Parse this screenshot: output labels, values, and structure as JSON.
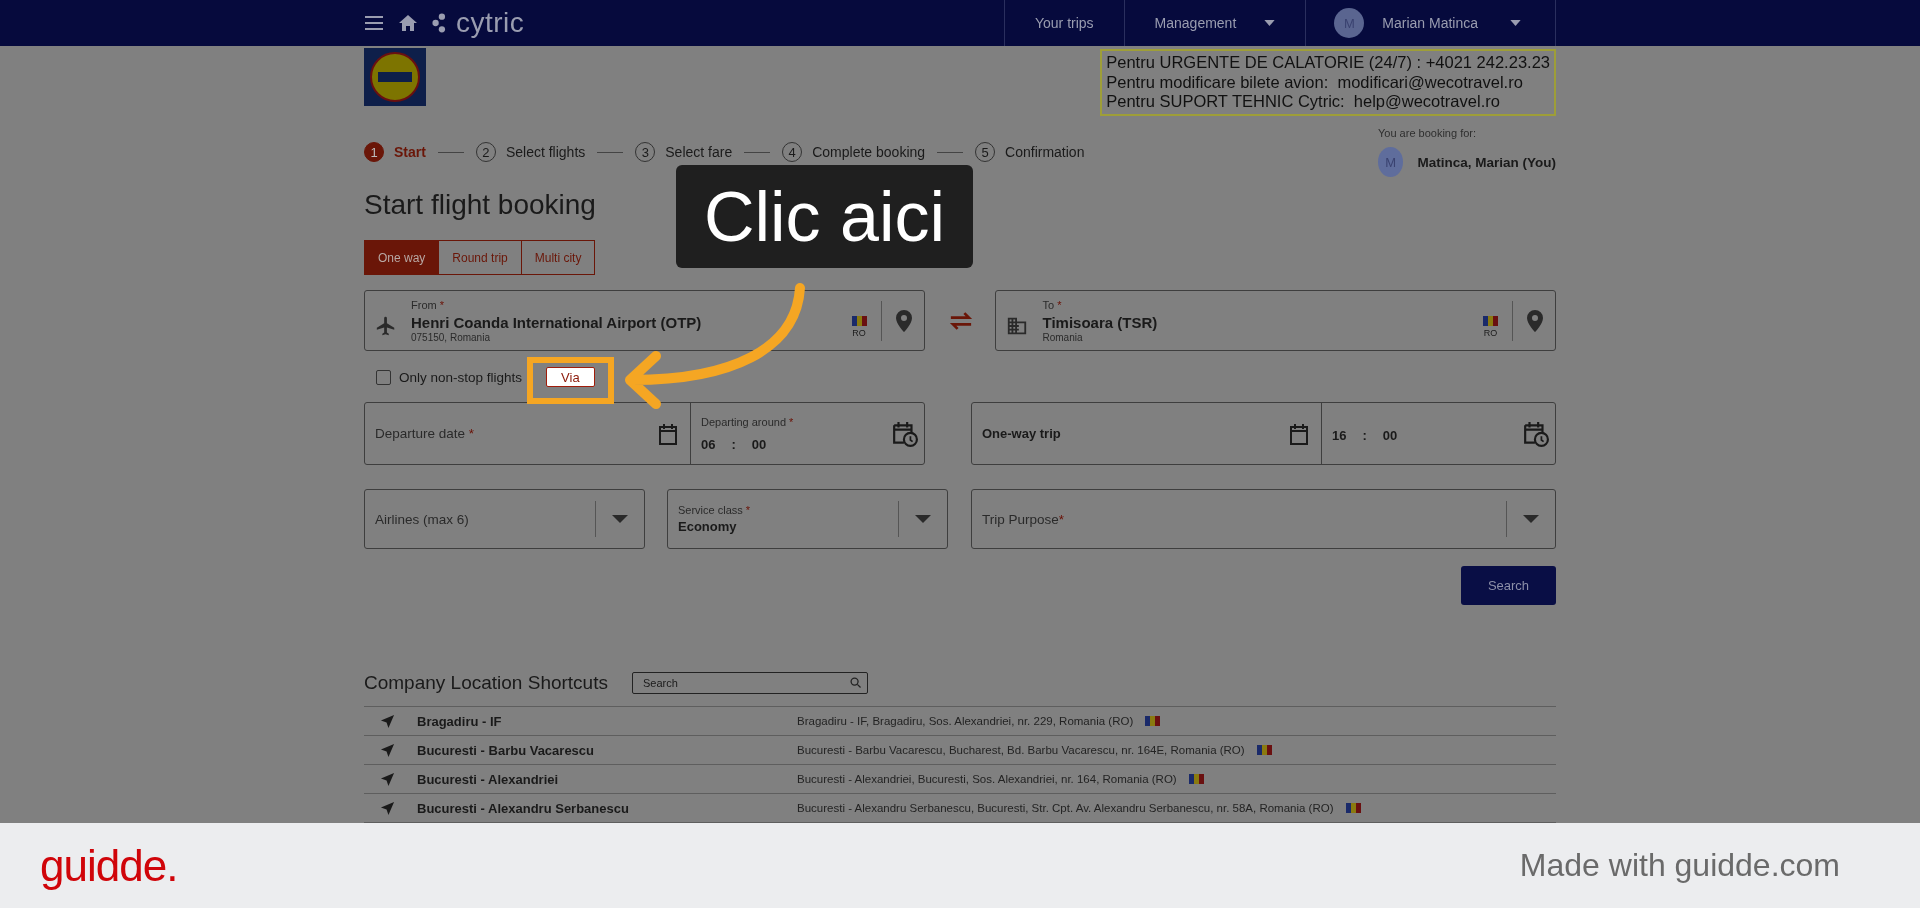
{
  "header": {
    "brand": "cytric",
    "nav": [
      {
        "label": "Your trips",
        "has_menu": false
      },
      {
        "label": "Management",
        "has_menu": true
      }
    ],
    "user": {
      "initial": "M",
      "name": "Marian Matinca"
    }
  },
  "contact_box": {
    "lines": [
      "Pentru URGENTE DE CALATORIE (24/7) : +4021 242.23.23",
      "Pentru modificare bilete avion:  modificari@wecotravel.ro",
      "Pentru SUPORT TEHNIC Cytric:  help@wecotravel.ro"
    ]
  },
  "steps": [
    {
      "number": "1",
      "label": "Start",
      "selected": true
    },
    {
      "number": "2",
      "label": "Select flights",
      "selected": false
    },
    {
      "number": "3",
      "label": "Select fare",
      "selected": false
    },
    {
      "number": "4",
      "label": "Complete booking",
      "selected": false
    },
    {
      "number": "5",
      "label": "Confirmation",
      "selected": false
    }
  ],
  "booking_for": {
    "label": "You are booking for:",
    "initial": "M",
    "name": "Matinca, Marian (You)"
  },
  "title": "Start flight booking",
  "trip_tabs": [
    {
      "label": "One way",
      "selected": true
    },
    {
      "label": "Round trip",
      "selected": false
    },
    {
      "label": "Multi city",
      "selected": false
    }
  ],
  "locations": [
    {
      "kind": "airport",
      "label": "From",
      "required_mark": "*",
      "value": "Henri Coanda International Airport (OTP)",
      "detail": "075150, Romania",
      "country": "RO"
    },
    {
      "kind": "city",
      "label": "To",
      "required_mark": "*",
      "value": "Timisoara (TSR)",
      "detail": "Romania",
      "country": "RO"
    }
  ],
  "nonstop": {
    "label": "Only non-stop flights",
    "checked": false
  },
  "via_button": "Via",
  "schedule": [
    {
      "kind": "placeholder",
      "date_text": "Departure date",
      "required_mark": "*",
      "time_label": "Departing around",
      "time_required_mark": "*",
      "hours": "06",
      "separator": ":",
      "minutes": "00"
    },
    {
      "kind": "value",
      "date_text": "One-way trip",
      "hours": "16",
      "separator": ":",
      "minutes": "00"
    }
  ],
  "selects": [
    {
      "kind": "placeholder",
      "text": "Airlines (max 6)"
    },
    {
      "kind": "value",
      "label": "Service class",
      "required_mark": "*",
      "text": "Economy"
    },
    {
      "kind": "placeholder",
      "text": "Trip Purpose",
      "required_mark": "*"
    }
  ],
  "search_button": "Search",
  "shortcuts": {
    "title": "Company Location Shortcuts",
    "search_placeholder": "Search",
    "rows": [
      {
        "name": "Bragadiru - IF",
        "address": "Bragadiru - IF, Bragadiru, Sos. Alexandriei, nr. 229, Romania (RO)"
      },
      {
        "name": "Bucuresti - Barbu Vacarescu",
        "address": "Bucuresti - Barbu Vacarescu, Bucharest, Bd. Barbu Vacarescu, nr. 164E, Romania (RO)"
      },
      {
        "name": "Bucuresti - Alexandriei",
        "address": "Bucuresti - Alexandriei, Bucuresti, Sos. Alexandriei, nr. 164, Romania (RO)"
      },
      {
        "name": "Bucuresti - Alexandru Serbanescu",
        "address": "Bucuresti - Alexandru Serbanescu, Bucuresti, Str. Cpt. Av. Alexandru Serbanescu, nr. 58A, Romania (RO)"
      }
    ]
  },
  "callout": {
    "text": "Clic aici"
  },
  "footer": {
    "brand": "guidde.",
    "credit": "Made with guidde.com"
  }
}
